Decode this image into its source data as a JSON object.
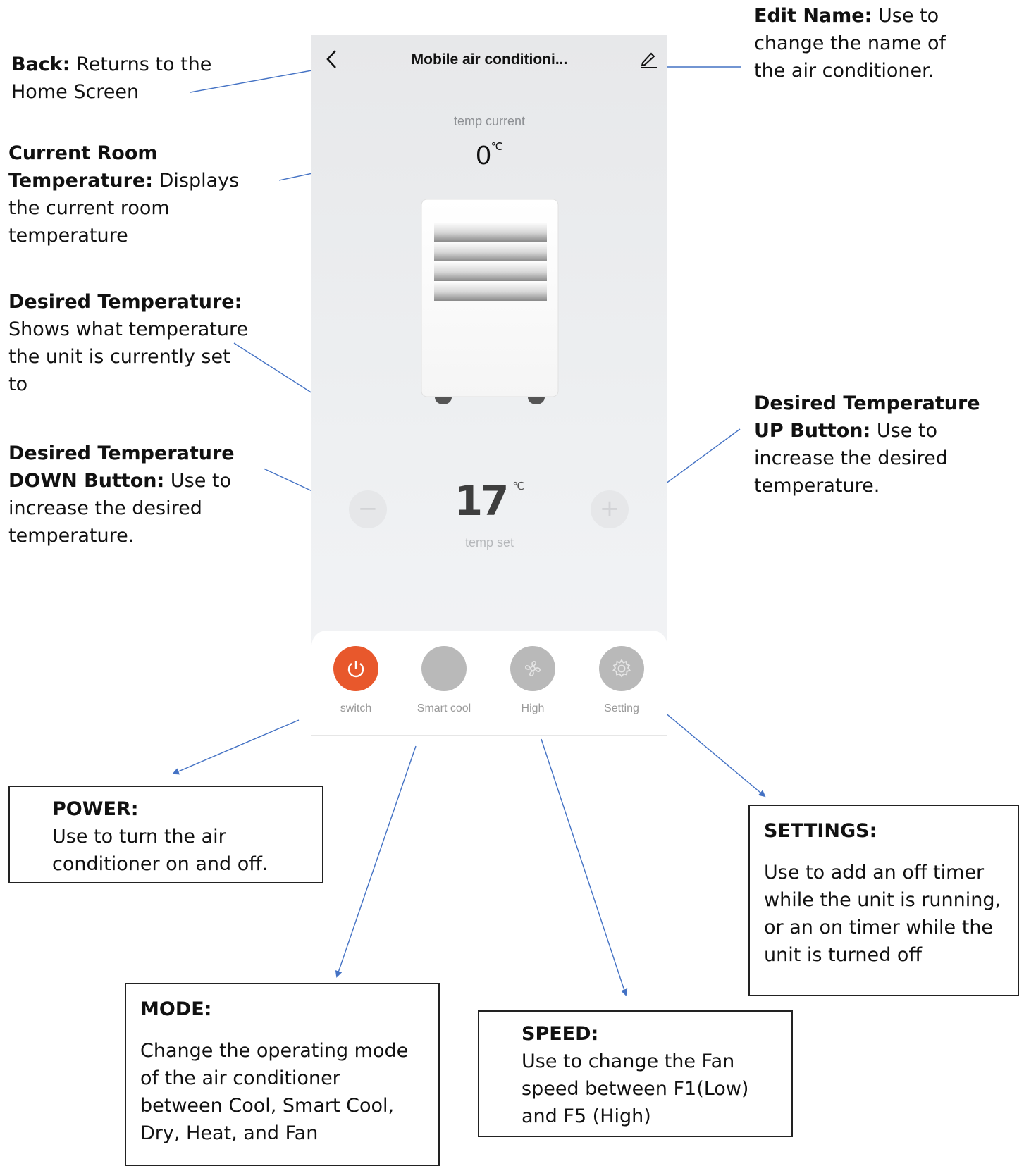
{
  "header": {
    "title": "Mobile air conditioni..."
  },
  "temperature": {
    "current_label": "temp current",
    "current_value": "0",
    "current_unit": "℃",
    "set_value": "17",
    "set_unit": "℃",
    "set_label": "temp set",
    "minus_glyph": "−",
    "plus_glyph": "+"
  },
  "controls": [
    {
      "label": "switch",
      "icon": "power-icon",
      "color": "#e8582c"
    },
    {
      "label": "Smart cool",
      "icon": "mode-icon",
      "color": "#b9b9b9"
    },
    {
      "label": "High",
      "icon": "fan-icon",
      "color": "#b9b9b9"
    },
    {
      "label": "Setting",
      "icon": "gear-icon",
      "color": "#b9b9b9"
    }
  ],
  "annotations": {
    "back": {
      "title": "Back:",
      "text": " Returns to the Home Screen"
    },
    "edit": {
      "title": "Edit Name:",
      "text": " Use to change the name of the air conditioner."
    },
    "current_room": {
      "title": "Current Room Temperature:",
      "text": " Displays the current room temperature"
    },
    "desired": {
      "title": "Desired Temperature:",
      "text": " Shows what temperature the unit is currently set to"
    },
    "down": {
      "title": "Desired Temperature DOWN Button:",
      "text": " Use to increase the desired temperature."
    },
    "up": {
      "title": "Desired Temperature UP Button:",
      "text": " Use to increase the desired temperature."
    }
  },
  "boxes": {
    "power": {
      "title": "POWER:",
      "text": "Use to turn the air conditioner on and off."
    },
    "mode": {
      "title": "MODE:",
      "text": "Change the operating mode of the air conditioner between Cool, Smart Cool, Dry, Heat, and Fan"
    },
    "speed": {
      "title": "SPEED:",
      "text": "Use to change the Fan speed between F1(Low) and F5 (High)"
    },
    "settings": {
      "title": "SETTINGS:",
      "text": "Use to add an off timer while the unit is running, or an on timer while the unit is turned off"
    }
  },
  "colors": {
    "accent": "#e8582c",
    "leader_line": "#4472c4"
  }
}
